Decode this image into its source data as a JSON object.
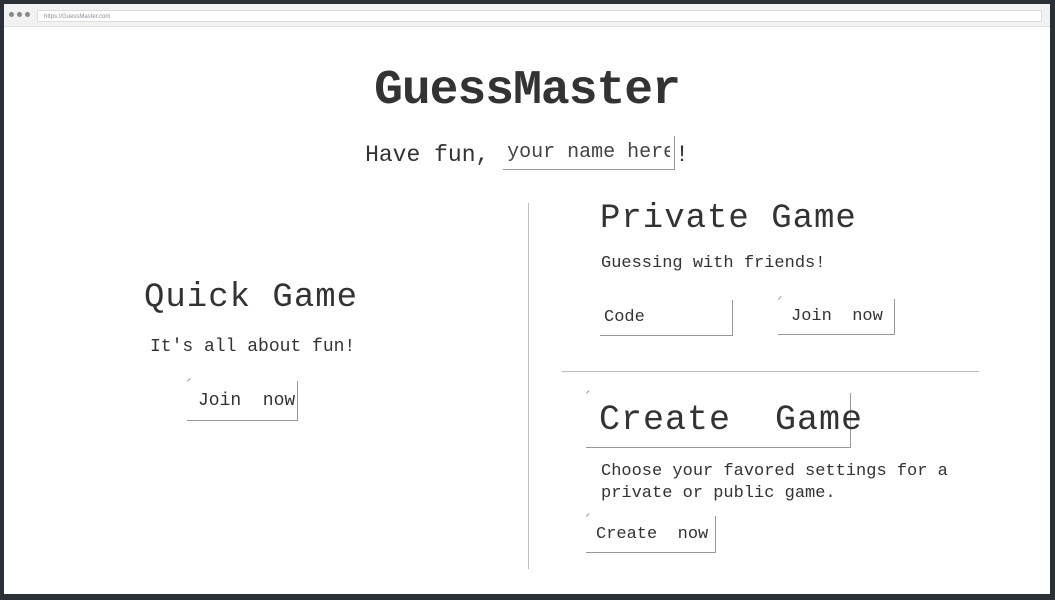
{
  "browser": {
    "url": "https://GuessMaster.com"
  },
  "header": {
    "title": "GuessMaster",
    "greeting_prefix": "Have fun, ",
    "name_placeholder": "your name here",
    "greeting_suffix": "!"
  },
  "quick_game": {
    "title": "Quick Game",
    "subtitle": "It's all about fun!",
    "join_label": "Join  now"
  },
  "private_game": {
    "title": "Private Game",
    "subtitle": "Guessing with friends!",
    "code_placeholder": "Code",
    "join_label": "Join  now"
  },
  "create_game": {
    "title": "Create  Game",
    "description": "Choose your favored settings for a private or public game.",
    "create_label": "Create  now"
  }
}
